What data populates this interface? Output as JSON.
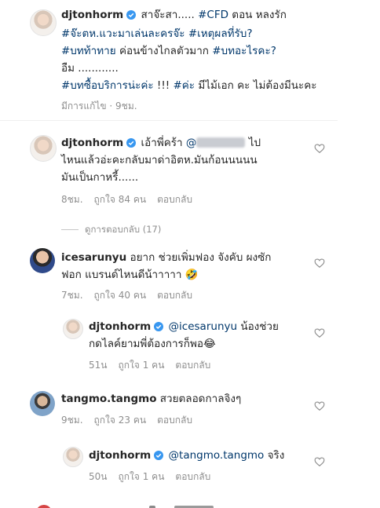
{
  "caption": {
    "username": "djtonhorm",
    "line1_text": "สาจ๊ะสา..... ",
    "line1_tag": "#CFD",
    "line1_rest": " ตอน หลงรัก",
    "line2_tag1": "#จ๊ะตห.แวะมาเล่นละครจ๊ะ",
    "line2_sep": " ",
    "line2_tag2": "#เหตุผลที่รับ?",
    "line3_tag1": "#บทท้าทาย",
    "line3_text": " ค่อนข้างไกลตัวมาก ",
    "line3_tag2": "#บทอะไรคะ?",
    "line4": "อืม ............",
    "line5_tag1": "#บทซื้อบริการน่ะค่ะ",
    "line5_text1": " !!! ",
    "line5_tag2": "#ค่ะ",
    "line5_text2": " มีไม้เอก คะ ไม่ต้องมีนะคะ",
    "meta": "มีการแก้ไข · 9ชม."
  },
  "comments": [
    {
      "username": "djtonhorm",
      "line1_pre": "เอ้าพี่คร้า ",
      "line1_mention": "@",
      "line1_post": " ไป",
      "line2": "ไหนแล้วอ่ะคะกลับมาด่าอิตห.มันก้อนนนนน",
      "line3": "มันเป็นกาหรี้......",
      "time": "8ชม.",
      "likes": "ถูกใจ 84 คน",
      "reply": "ตอบกลับ",
      "view_replies": "ดูการตอบกลับ (17)"
    },
    {
      "username": "icesarunyu",
      "line1_text": "อยาก ช่วยเพิ่มฟอง จังคับ ผงซัก",
      "line2": "ฟอก แบรนด์ไหนดีน้าาาาา 🤣",
      "time": "7ชม.",
      "likes": "ถูกใจ 40 คน",
      "reply": "ตอบกลับ"
    },
    {
      "username": "djtonhorm",
      "line1_mention": "@icesarunyu",
      "line1_post": " น้องช่วย",
      "line2": "กดไลค์ยามพี่ต้องการก็พอ😂",
      "time": "51น",
      "likes": "ถูกใจ 1 คน",
      "reply": "ตอบกลับ"
    },
    {
      "username": "tangmo.tangmo",
      "line1_text": "สวยตลอดกาลจิงๆ",
      "time": "9ชม.",
      "likes": "ถูกใจ 23 คน",
      "reply": "ตอบกลับ"
    },
    {
      "username": "djtonhorm",
      "line1_mention": "@tangmo.tangmo",
      "line1_post": " จริง",
      "time": "50น",
      "likes": "ถูกใจ 1 คน",
      "reply": "ตอบกลับ"
    }
  ],
  "colors": {
    "link": "#00376b",
    "muted": "#8e8e8e",
    "verified": "#3897f0"
  }
}
